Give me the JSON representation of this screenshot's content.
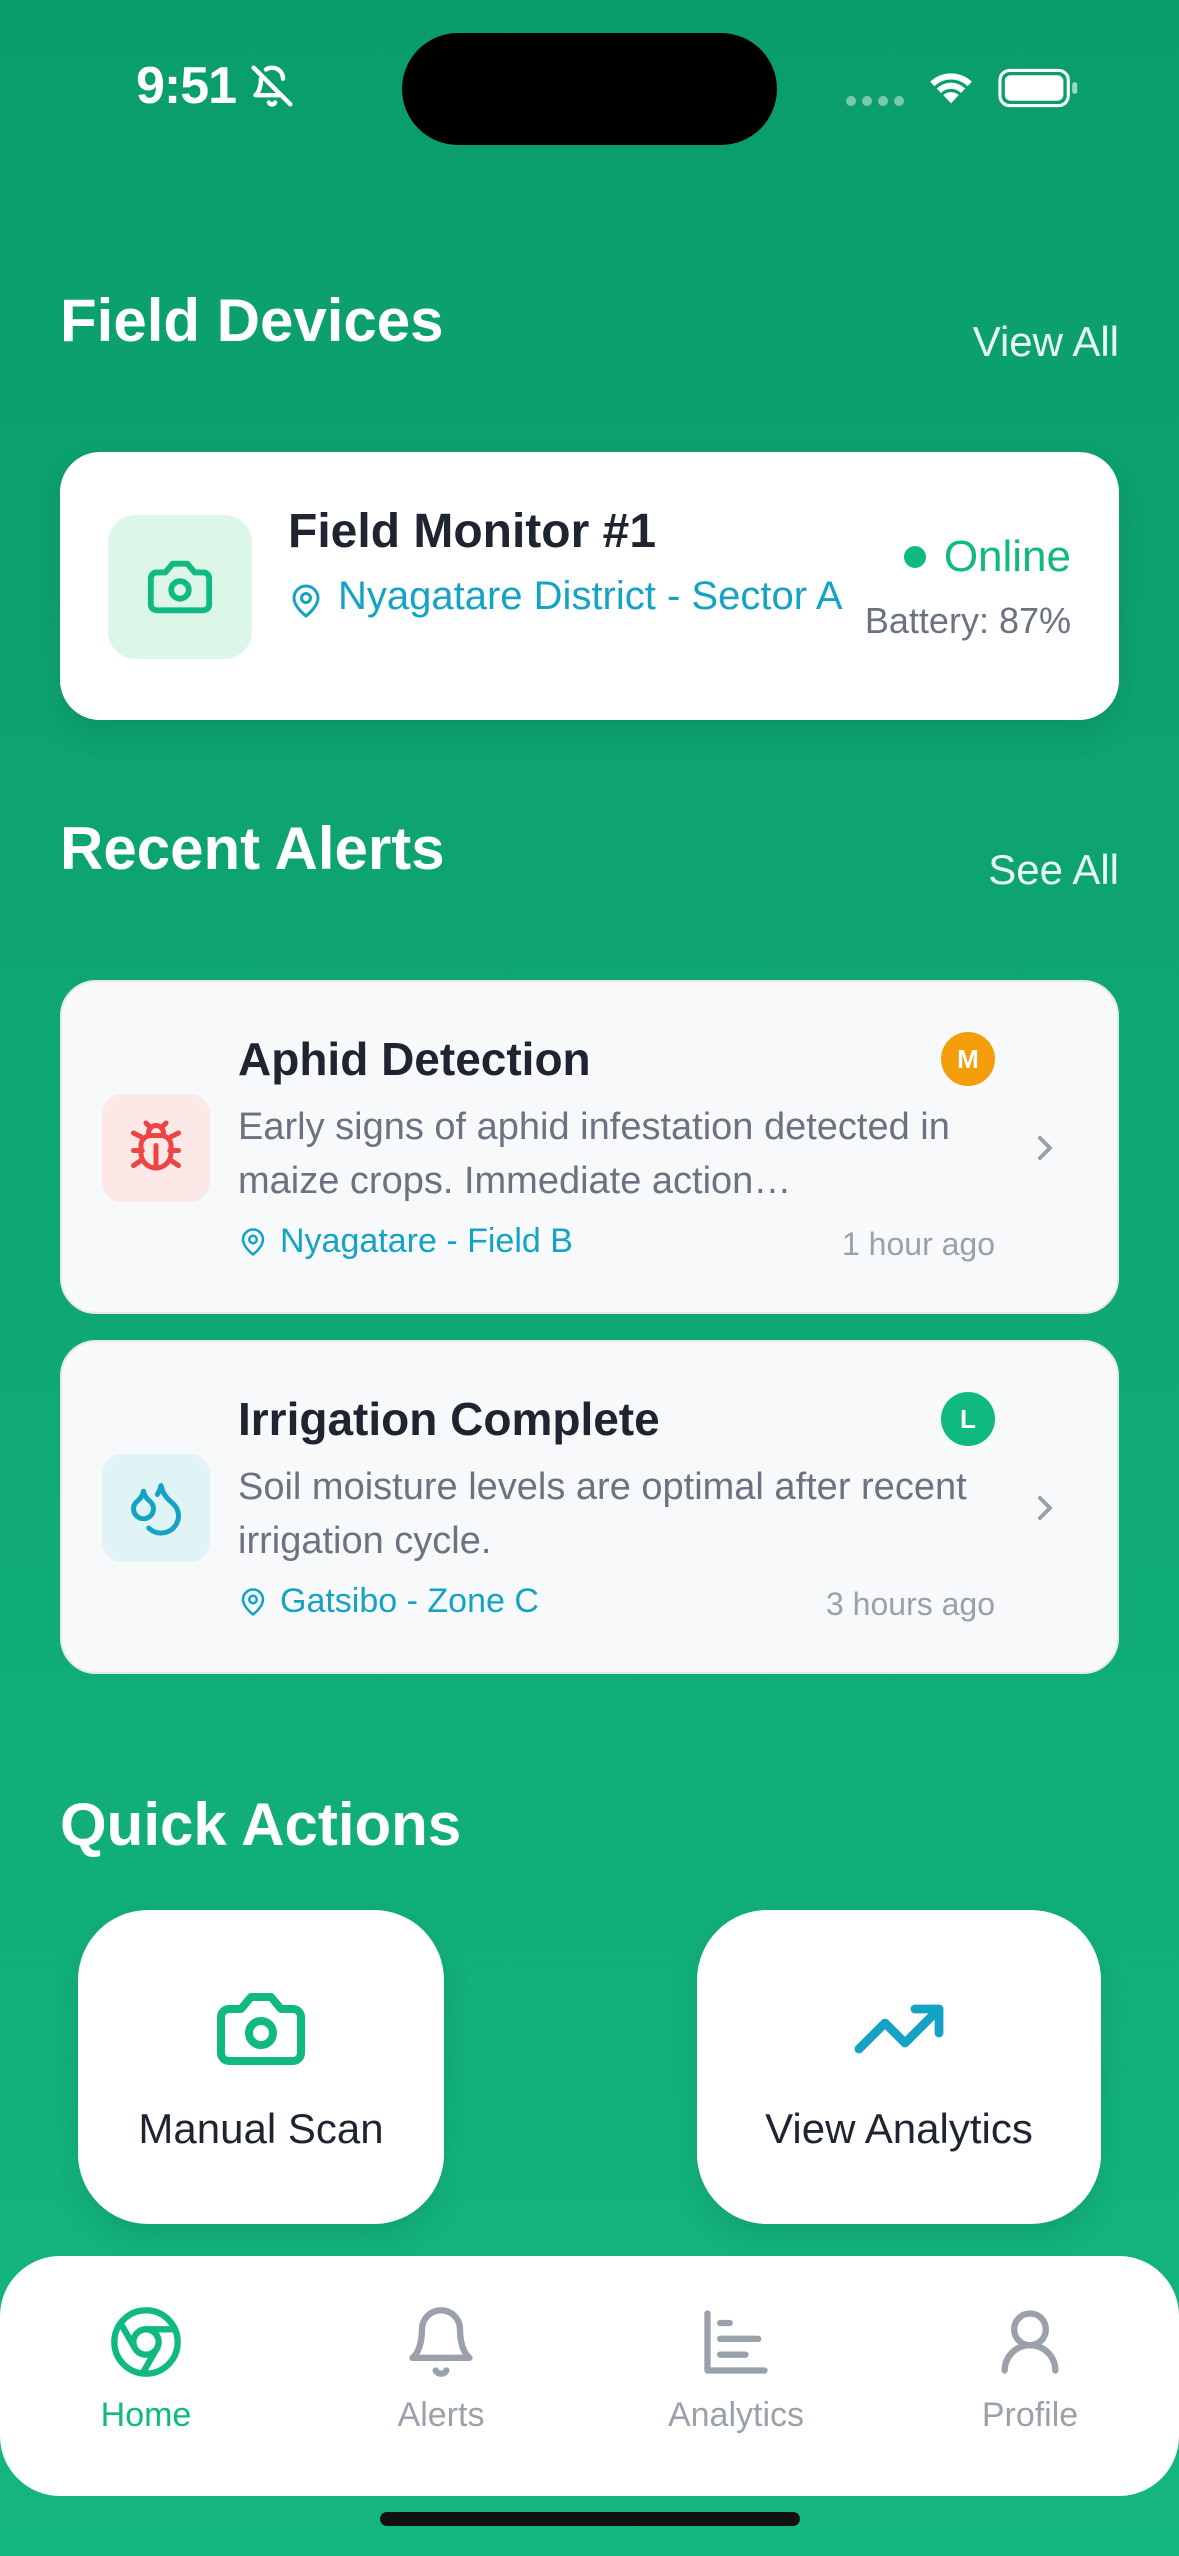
{
  "status_bar": {
    "time": "9:51"
  },
  "sections": {
    "devices_title": "Field Devices",
    "devices_link": "View All",
    "alerts_title": "Recent Alerts",
    "alerts_link": "See All",
    "actions_title": "Quick Actions"
  },
  "device": {
    "name": "Field Monitor #1",
    "location": "Nyagatare District - Sector A",
    "status": "Online",
    "battery": "Battery: 87%"
  },
  "alerts": [
    {
      "title": "Aphid Detection",
      "description": "Early signs of aphid infestation detected in maize crops. Immediate action recommended.",
      "location": "Nyagatare - Field B",
      "time": "1 hour ago",
      "severity": "M",
      "icon": "bug-icon",
      "severity_color": "#f59e0b"
    },
    {
      "title": "Irrigation Complete",
      "description": "Soil moisture levels are optimal after recent irrigation cycle.",
      "location": "Gatsibo - Zone C",
      "time": "3 hours ago",
      "severity": "L",
      "icon": "droplets-icon",
      "severity_color": "#10b981"
    }
  ],
  "quick_actions": [
    {
      "label": "Manual Scan",
      "icon": "camera-icon"
    },
    {
      "label": "View Analytics",
      "icon": "trending-up-icon"
    }
  ],
  "tabs": [
    {
      "label": "Home",
      "icon": "home-chrome-icon",
      "active": true
    },
    {
      "label": "Alerts",
      "icon": "bell-icon",
      "active": false
    },
    {
      "label": "Analytics",
      "icon": "bar-chart-icon",
      "active": false
    },
    {
      "label": "Profile",
      "icon": "user-icon",
      "active": false
    }
  ],
  "colors": {
    "accent": "#10b981",
    "link": "#14a3c4",
    "background": "#0fa874"
  }
}
